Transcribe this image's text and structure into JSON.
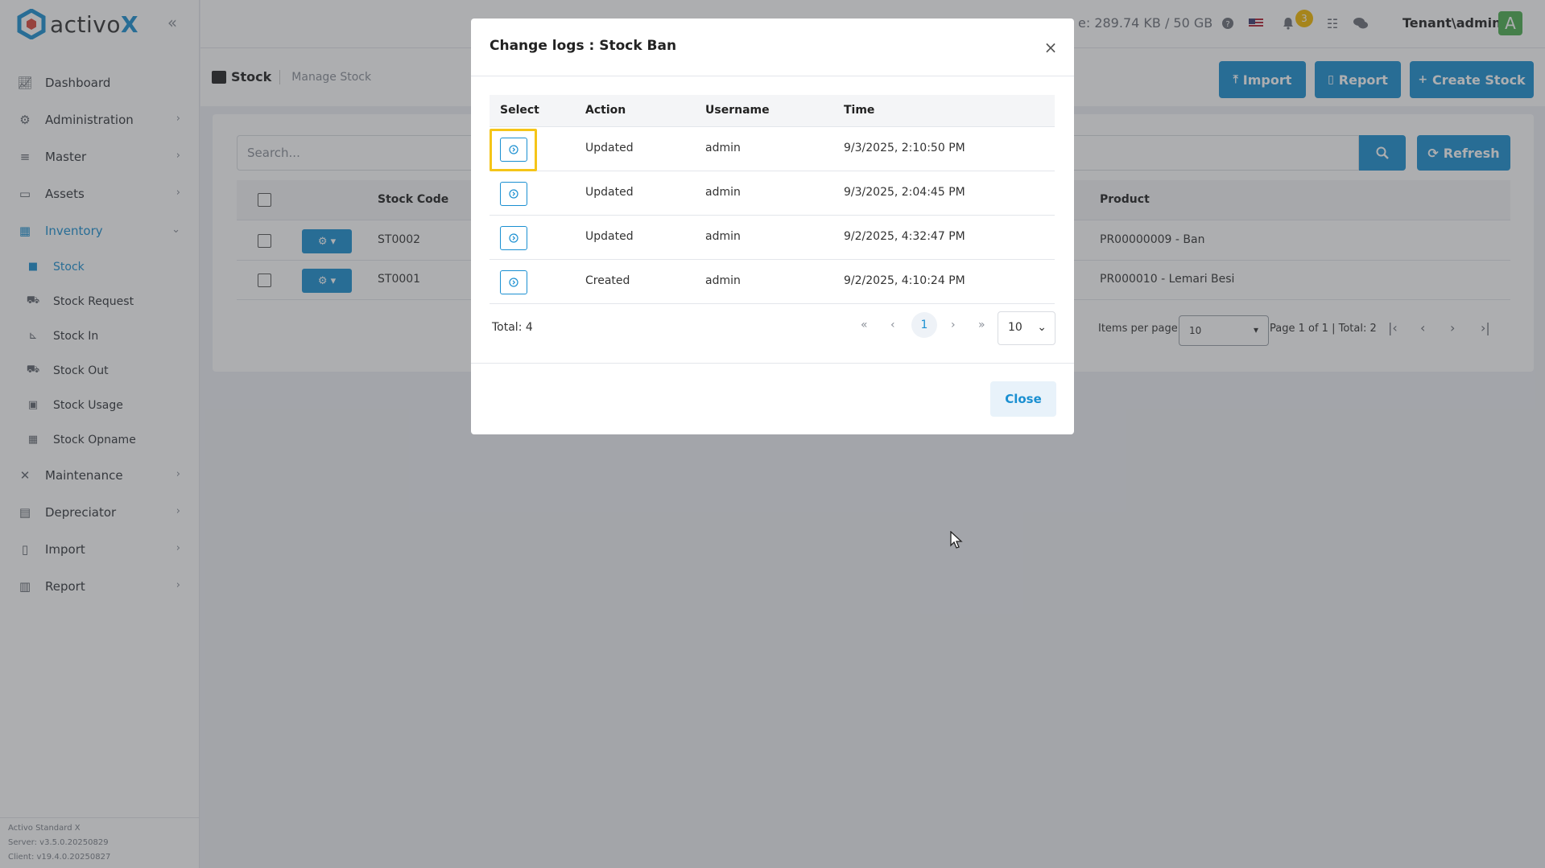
{
  "app": {
    "brand": {
      "name": "activo",
      "suffix": "X"
    },
    "storage_text": "e: 289.74 KB / 50 GB",
    "notification_count": "3",
    "user": {
      "name": "Tenant\\admin",
      "avatar_letter": "A"
    },
    "accent_color": "#1a8fd1"
  },
  "sidebar": {
    "items": [
      {
        "label": "Dashboard",
        "icon": "chart-line-icon",
        "has_chevron": false
      },
      {
        "label": "Administration",
        "icon": "gears-icon",
        "has_chevron": true
      },
      {
        "label": "Master",
        "icon": "database-icon",
        "has_chevron": true
      },
      {
        "label": "Assets",
        "icon": "laptop-icon",
        "has_chevron": true
      },
      {
        "label": "Inventory",
        "icon": "warehouse-icon",
        "has_chevron": true,
        "expanded": true,
        "active": true
      },
      {
        "label": "Maintenance",
        "icon": "tools-icon",
        "has_chevron": true
      },
      {
        "label": "Depreciator",
        "icon": "clipboard-icon",
        "has_chevron": true
      },
      {
        "label": "Import",
        "icon": "file-import-icon",
        "has_chevron": true
      },
      {
        "label": "Report",
        "icon": "bar-chart-icon",
        "has_chevron": true
      }
    ],
    "inventory_subitems": [
      {
        "label": "Stock",
        "icon": "box-icon",
        "active": true
      },
      {
        "label": "Stock Request",
        "icon": "truck-icon"
      },
      {
        "label": "Stock In",
        "icon": "dolly-icon"
      },
      {
        "label": "Stock Out",
        "icon": "truck-out-icon"
      },
      {
        "label": "Stock Usage",
        "icon": "clipboard-check-icon"
      },
      {
        "label": "Stock Opname",
        "icon": "warehouse-icon"
      }
    ],
    "footer": {
      "product": "Activo Standard X",
      "server": "Server: v3.5.0.20250829",
      "client": "Client: v19.4.0.20250827"
    }
  },
  "page_header": {
    "title": "Stock",
    "subtitle": "Manage Stock",
    "buttons": {
      "import": "Import",
      "report": "Report",
      "create": "Create Stock"
    }
  },
  "stock_list": {
    "search_placeholder": "Search...",
    "refresh_label": "Refresh",
    "columns": {
      "code": "Stock Code",
      "product": "Product"
    },
    "rows": [
      {
        "code": "ST0002",
        "product": "PR00000009 - Ban"
      },
      {
        "code": "ST0001",
        "product": "PR000010 - Lemari Besi"
      }
    ],
    "items_per_page_label": "Items per page",
    "items_per_page_value": "10",
    "page_info": "Page 1 of 1 | Total: 2"
  },
  "modal": {
    "title": "Change logs : Stock Ban",
    "columns": {
      "select": "Select",
      "action": "Action",
      "username": "Username",
      "time": "Time"
    },
    "rows": [
      {
        "action": "Updated",
        "username": "admin",
        "time": "9/3/2025, 2:10:50 PM"
      },
      {
        "action": "Updated",
        "username": "admin",
        "time": "9/3/2025, 2:04:45 PM"
      },
      {
        "action": "Updated",
        "username": "admin",
        "time": "9/2/2025, 4:32:47 PM"
      },
      {
        "action": "Created",
        "username": "admin",
        "time": "9/2/2025, 4:10:24 PM"
      }
    ],
    "total": "Total: 4",
    "current_page": "1",
    "page_size": "10",
    "close_label": "Close"
  }
}
